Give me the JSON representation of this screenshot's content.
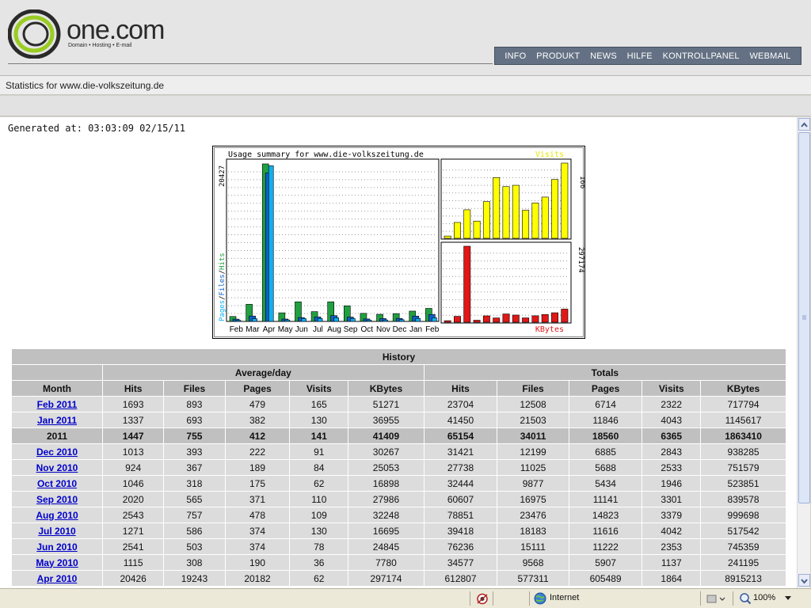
{
  "brand": {
    "name": "one.com",
    "tagline": "Domain • Hosting • E-mail"
  },
  "nav": {
    "items": [
      "INFO",
      "PRODUKT",
      "NEWS",
      "HILFE",
      "KONTROLLPANEL",
      "WEBMAIL"
    ],
    "bg_color": "#647184"
  },
  "stats_title": "Statistics for www.die-volkszeitung.de",
  "generated": "Generated at: 03:03:09 02/15/11",
  "chart_data": [
    {
      "type": "bar",
      "title": "Usage summary for www.die-volkszeitung.de",
      "ylabel": "Pages/Files/Hits",
      "ymax_label": "20427",
      "ylim": [
        0,
        20427
      ],
      "categories": [
        "Feb",
        "Mar",
        "Apr",
        "May",
        "Jun",
        "Jul",
        "Aug",
        "Sep",
        "Oct",
        "Nov",
        "Dec",
        "Jan",
        "Feb"
      ],
      "series": [
        {
          "name": "Hits",
          "color": "#20a040",
          "values": [
            640,
            2220,
            20426,
            1115,
            2541,
            1271,
            2543,
            2020,
            1046,
            924,
            1013,
            1337,
            1693
          ]
        },
        {
          "name": "Files",
          "color": "#1060c8",
          "values": [
            300,
            700,
            19243,
            308,
            503,
            586,
            757,
            565,
            318,
            367,
            393,
            693,
            893
          ]
        },
        {
          "name": "Pages",
          "color": "#10b0f0",
          "values": [
            150,
            350,
            20182,
            190,
            374,
            374,
            478,
            371,
            175,
            189,
            222,
            382,
            479
          ]
        }
      ]
    },
    {
      "type": "bar",
      "series": [
        {
          "name": "Visits",
          "color": "#ffff00",
          "values": [
            5,
            35,
            63,
            38,
            81,
            134,
            114,
            117,
            62,
            78,
            91,
            130,
            166
          ]
        }
      ],
      "ymax_label": "166",
      "ylim": [
        0,
        166
      ]
    },
    {
      "type": "bar",
      "series": [
        {
          "name": "KBytes",
          "color": "#e01818",
          "values": [
            6000,
            23000,
            297174,
            7780,
            24845,
            16695,
            32248,
            27986,
            16898,
            25053,
            30267,
            36955,
            51271
          ]
        }
      ],
      "ymax_label": "297174",
      "ylim": [
        0,
        297174
      ]
    }
  ],
  "history": {
    "title": "History",
    "group_headers": [
      "Average/day",
      "Totals"
    ],
    "columns": [
      "Month",
      "Hits",
      "Files",
      "Pages",
      "Visits",
      "KBytes",
      "Hits",
      "Files",
      "Pages",
      "Visits",
      "KBytes"
    ],
    "rows": [
      {
        "type": "month",
        "cells": [
          "Feb 2011",
          "1693",
          "893",
          "479",
          "165",
          "51271",
          "23704",
          "12508",
          "6714",
          "2322",
          "717794"
        ]
      },
      {
        "type": "month",
        "cells": [
          "Jan 2011",
          "1337",
          "693",
          "382",
          "130",
          "36955",
          "41450",
          "21503",
          "11846",
          "4043",
          "1145617"
        ]
      },
      {
        "type": "year",
        "cells": [
          "2011",
          "1447",
          "755",
          "412",
          "141",
          "41409",
          "65154",
          "34011",
          "18560",
          "6365",
          "1863410"
        ]
      },
      {
        "type": "month",
        "cells": [
          "Dec 2010",
          "1013",
          "393",
          "222",
          "91",
          "30267",
          "31421",
          "12199",
          "6885",
          "2843",
          "938285"
        ]
      },
      {
        "type": "month",
        "cells": [
          "Nov 2010",
          "924",
          "367",
          "189",
          "84",
          "25053",
          "27738",
          "11025",
          "5688",
          "2533",
          "751579"
        ]
      },
      {
        "type": "month",
        "cells": [
          "Oct 2010",
          "1046",
          "318",
          "175",
          "62",
          "16898",
          "32444",
          "9877",
          "5434",
          "1946",
          "523851"
        ]
      },
      {
        "type": "month",
        "cells": [
          "Sep 2010",
          "2020",
          "565",
          "371",
          "110",
          "27986",
          "60607",
          "16975",
          "11141",
          "3301",
          "839578"
        ]
      },
      {
        "type": "month",
        "cells": [
          "Aug 2010",
          "2543",
          "757",
          "478",
          "109",
          "32248",
          "78851",
          "23476",
          "14823",
          "3379",
          "999698"
        ]
      },
      {
        "type": "month",
        "cells": [
          "Jul 2010",
          "1271",
          "586",
          "374",
          "130",
          "16695",
          "39418",
          "18183",
          "11616",
          "4042",
          "517542"
        ]
      },
      {
        "type": "month",
        "cells": [
          "Jun 2010",
          "2541",
          "503",
          "374",
          "78",
          "24845",
          "76236",
          "15111",
          "11222",
          "2353",
          "745359"
        ]
      },
      {
        "type": "month",
        "cells": [
          "May 2010",
          "1115",
          "308",
          "190",
          "36",
          "7780",
          "34577",
          "9568",
          "5907",
          "1137",
          "241195"
        ]
      },
      {
        "type": "month",
        "cells": [
          "Apr 2010",
          "20426",
          "19243",
          "20182",
          "62",
          "297174",
          "612807",
          "577311",
          "605489",
          "1864",
          "8915213"
        ]
      }
    ]
  },
  "statusbar": {
    "zone": "Internet",
    "zoom": "100%"
  }
}
